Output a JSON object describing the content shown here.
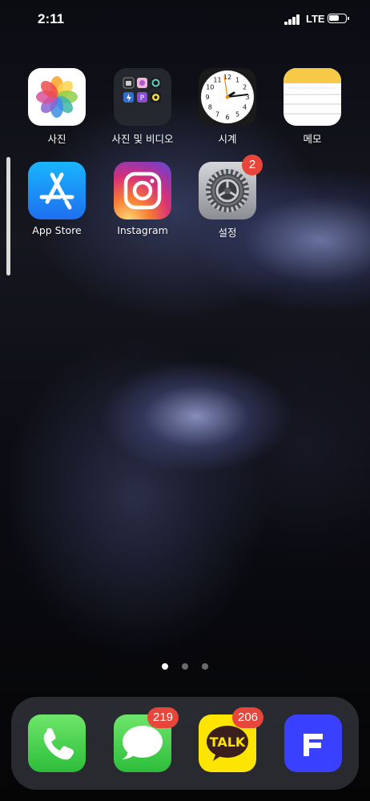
{
  "status_bar": {
    "time": "2:11",
    "network": "LTE"
  },
  "home_apps": [
    {
      "label": "사진",
      "icon": "photos-icon"
    },
    {
      "label": "사진 및 비디오",
      "icon": "folder-icon"
    },
    {
      "label": "시계",
      "icon": "clock-icon"
    },
    {
      "label": "메모",
      "icon": "notes-icon"
    },
    {
      "label": "App Store",
      "icon": "app-store-icon"
    },
    {
      "label": "Instagram",
      "icon": "instagram-icon"
    },
    {
      "label": "설정",
      "icon": "settings-icon",
      "badge": "2"
    }
  ],
  "clock_numbers": [
    "12",
    "1",
    "2",
    "3",
    "4",
    "5",
    "6",
    "7",
    "8",
    "9",
    "10",
    "11"
  ],
  "dock": [
    {
      "app": "Phone",
      "icon": "phone-icon"
    },
    {
      "app": "Messages",
      "icon": "messages-icon",
      "badge": "219"
    },
    {
      "app": "KakaoTalk",
      "icon": "kakaotalk-icon",
      "badge": "206",
      "icon_text": "TALK"
    },
    {
      "app": "Flex",
      "icon": "flex-icon"
    }
  ],
  "page_dots": {
    "count": 3,
    "active": 1
  },
  "colors": {
    "badge": "#e8463a",
    "app_store": "#1e8cf7",
    "kakao": "#fde500",
    "flex": "#3a40ff"
  }
}
